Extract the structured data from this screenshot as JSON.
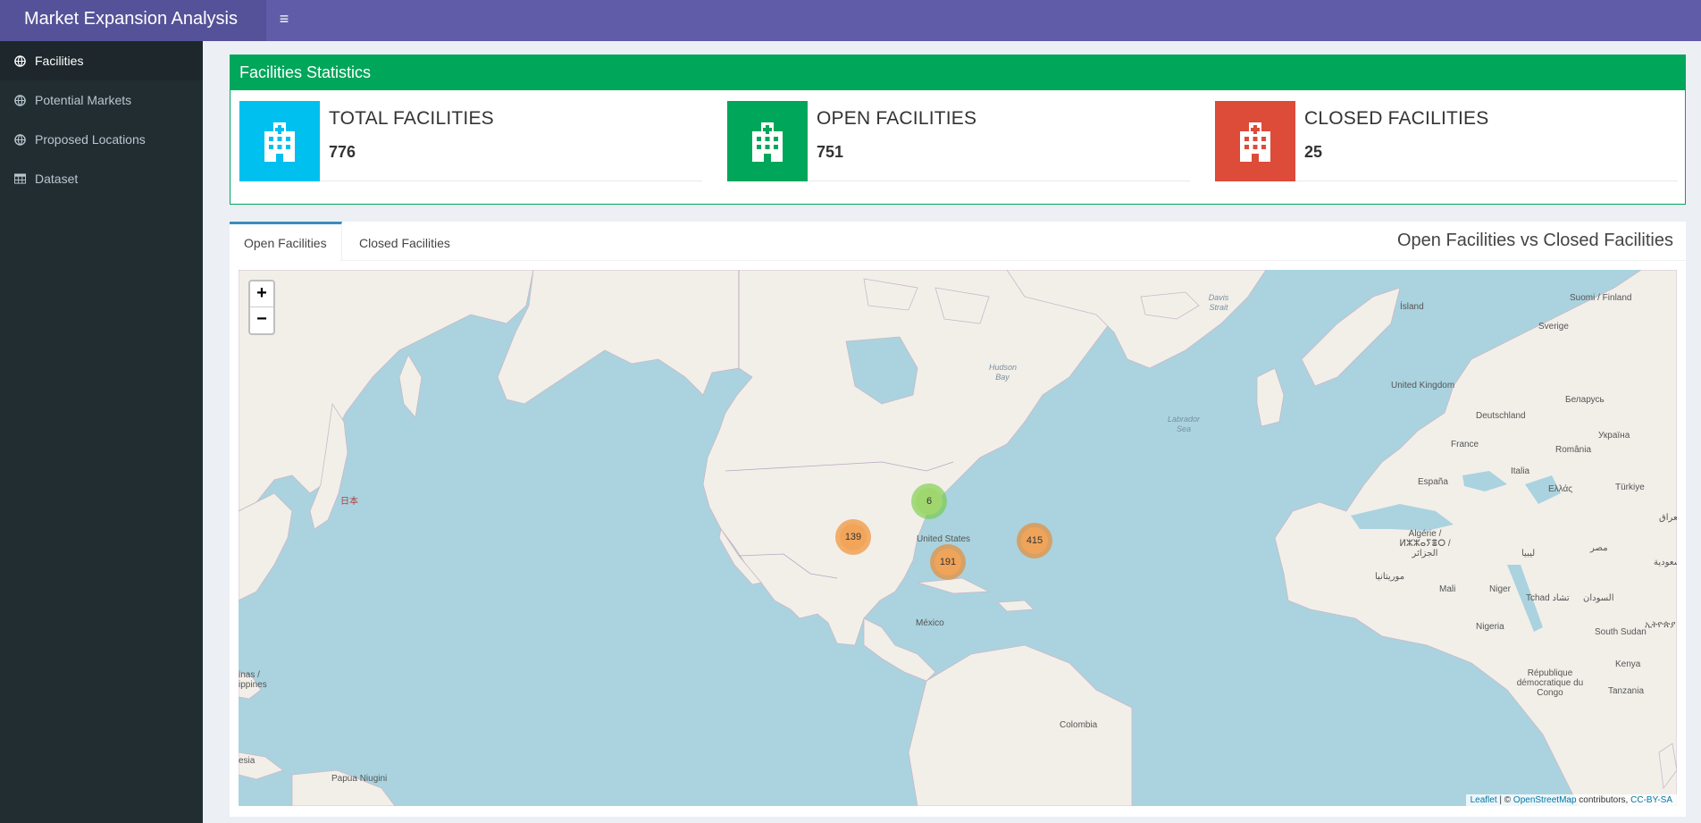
{
  "header": {
    "app_title": "Market Expansion Analysis",
    "menu_icon": "hamburger-icon",
    "brand_color": "#605ca8"
  },
  "sidebar": {
    "items": [
      {
        "label": "Facilities",
        "icon": "globe-icon",
        "active": true
      },
      {
        "label": "Potential Markets",
        "icon": "globe-icon"
      },
      {
        "label": "Proposed Locations",
        "icon": "globe-icon"
      },
      {
        "label": "Dataset",
        "icon": "table-icon"
      }
    ]
  },
  "stats": {
    "title": "Facilities Statistics",
    "cards": [
      {
        "label": "TOTAL FACILITIES",
        "value": "776",
        "color": "#00c0ef",
        "icon": "hospital-icon"
      },
      {
        "label": "OPEN FACILITIES",
        "value": "751",
        "color": "#00a65a",
        "icon": "hospital-icon"
      },
      {
        "label": "CLOSED FACILITIES",
        "value": "25",
        "color": "#dd4b39",
        "icon": "hospital-icon"
      }
    ]
  },
  "tabs": {
    "items": [
      "Open Facilities",
      "Closed Facilities"
    ],
    "active": "Open Facilities",
    "title": "Open Facilities vs Closed Facilities"
  },
  "map": {
    "zoom_in": "+",
    "zoom_out": "−",
    "clusters": [
      {
        "count": "6",
        "color": "green"
      },
      {
        "count": "139",
        "color": "orange"
      },
      {
        "count": "191",
        "color": "orange"
      },
      {
        "count": "415",
        "color": "orange"
      }
    ],
    "labels": [
      "Suomi / Finland",
      "Ísland",
      "Sverige",
      "Davis Strait",
      "Hudson Bay",
      "Labrador Sea",
      "United Kingdom",
      "Беларусь",
      "Deutschland",
      "Україна",
      "France",
      "România",
      "Italia",
      "España",
      "Ελλάς",
      "Türkiye",
      "العراق",
      "Algérie / ⵍⵣⵣⴰⵢⴻⵔ / الجزائر",
      "ليبيا",
      "مصر",
      "السعودية",
      "موريتانيا",
      "Mali",
      "Niger",
      "Tchad تشاد",
      "السودان",
      "Nigeria",
      "ኢትዮጵያ",
      "South Sudan",
      "République démocratique du Congo",
      "Kenya",
      "Tanzania",
      "United States",
      "México",
      "Colombia",
      "日本",
      "Papua Niugini",
      "inas / ippines",
      "esia"
    ],
    "attribution": {
      "leaflet": "Leaflet",
      "sep": " | © ",
      "osm": "OpenStreetMap",
      "contrib": " contributors, ",
      "license": "CC-BY-SA"
    }
  }
}
